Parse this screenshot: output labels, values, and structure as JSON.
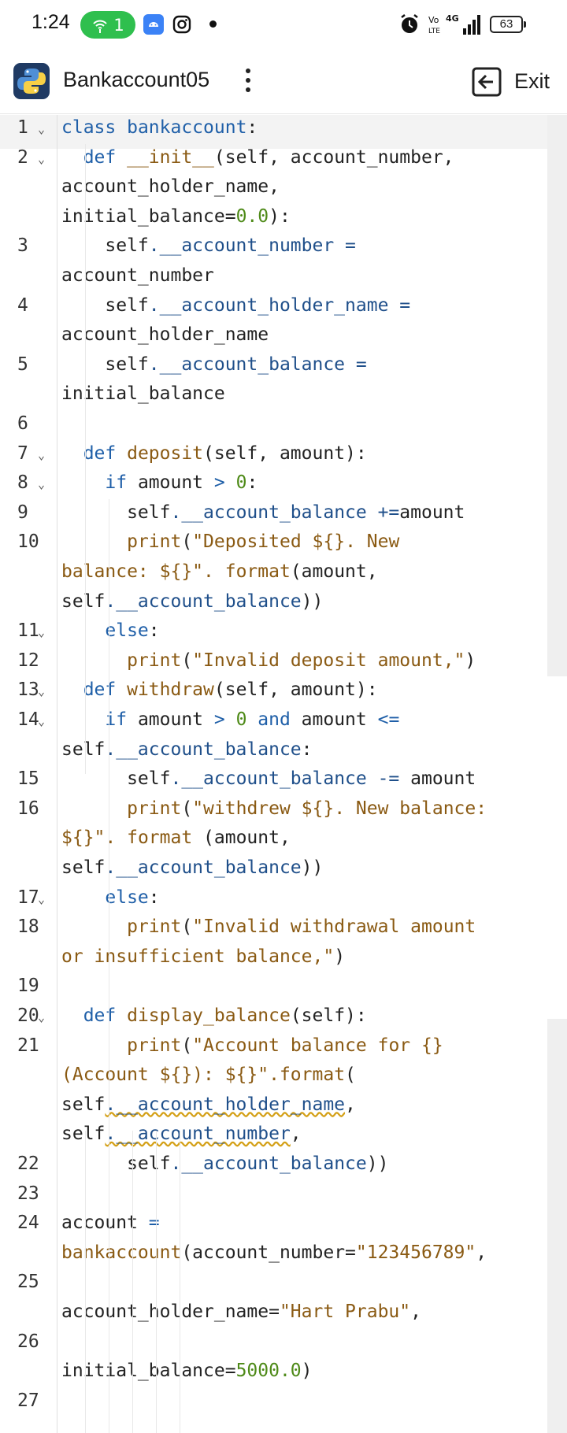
{
  "status_bar": {
    "time": "1:24",
    "hotspot_count": "1",
    "battery": "63",
    "network": "4G"
  },
  "app_bar": {
    "title": "Bankaccount05",
    "exit_label": "Exit"
  },
  "editor": {
    "active_line": "1",
    "lines": [
      {
        "n": "1",
        "fold": true
      },
      {
        "n": "2",
        "fold": true
      },
      {
        "n": "3",
        "fold": false
      },
      {
        "n": "4",
        "fold": false
      },
      {
        "n": "5",
        "fold": false
      },
      {
        "n": "6",
        "fold": false
      },
      {
        "n": "7",
        "fold": true
      },
      {
        "n": "8",
        "fold": true
      },
      {
        "n": "9",
        "fold": false
      },
      {
        "n": "10",
        "fold": false
      },
      {
        "n": "11",
        "fold": true
      },
      {
        "n": "12",
        "fold": false
      },
      {
        "n": "13",
        "fold": true
      },
      {
        "n": "14",
        "fold": true
      },
      {
        "n": "15",
        "fold": false
      },
      {
        "n": "16",
        "fold": false
      },
      {
        "n": "17",
        "fold": true
      },
      {
        "n": "18",
        "fold": false
      },
      {
        "n": "19",
        "fold": false
      },
      {
        "n": "20",
        "fold": true
      },
      {
        "n": "21",
        "fold": false
      },
      {
        "n": "22",
        "fold": false
      },
      {
        "n": "23",
        "fold": false
      },
      {
        "n": "24",
        "fold": false
      },
      {
        "n": "25",
        "fold": false
      },
      {
        "n": "26",
        "fold": false
      },
      {
        "n": "27",
        "fold": false
      }
    ],
    "rows": [
      [
        {
          "t": "class ",
          "c": "kw"
        },
        {
          "t": "bankaccount",
          "c": "kw"
        },
        {
          "t": ":",
          "c": ""
        }
      ],
      [
        {
          "t": "  def ",
          "c": "kw"
        },
        {
          "t": "__init__",
          "c": "str"
        },
        {
          "t": "(self, account_number,",
          "c": ""
        }
      ],
      [
        {
          "t": "account_holder_name,",
          "c": ""
        }
      ],
      [
        {
          "t": "initial_balance=",
          "c": ""
        },
        {
          "t": "0.0",
          "c": "num"
        },
        {
          "t": "):",
          "c": ""
        }
      ],
      [
        {
          "t": "    self",
          "c": ""
        },
        {
          "t": ".__account_number =",
          "c": "mem"
        }
      ],
      [
        {
          "t": "account_number",
          "c": ""
        }
      ],
      [
        {
          "t": "    self",
          "c": ""
        },
        {
          "t": ".__account_holder_name =",
          "c": "mem"
        }
      ],
      [
        {
          "t": "account_holder_name",
          "c": ""
        }
      ],
      [
        {
          "t": "    self",
          "c": ""
        },
        {
          "t": ".__account_balance =",
          "c": "mem"
        }
      ],
      [
        {
          "t": "initial_balance",
          "c": ""
        }
      ],
      [
        {
          "t": "",
          "c": ""
        }
      ],
      [
        {
          "t": "  def ",
          "c": "kw"
        },
        {
          "t": "deposit",
          "c": "str"
        },
        {
          "t": "(self, amount):",
          "c": ""
        }
      ],
      [
        {
          "t": "    if ",
          "c": "kw"
        },
        {
          "t": "amount ",
          "c": ""
        },
        {
          "t": "> ",
          "c": "kw"
        },
        {
          "t": "0",
          "c": "num"
        },
        {
          "t": ":",
          "c": ""
        }
      ],
      [
        {
          "t": "      self",
          "c": ""
        },
        {
          "t": ".__account_balance +=",
          "c": "mem"
        },
        {
          "t": "amount",
          "c": ""
        }
      ],
      [
        {
          "t": "      ",
          "c": ""
        },
        {
          "t": "print",
          "c": "str"
        },
        {
          "t": "(",
          "c": ""
        },
        {
          "t": "\"Deposited ${}. New",
          "c": "str"
        }
      ],
      [
        {
          "t": "balance: ${}\". ",
          "c": "str"
        },
        {
          "t": "format",
          "c": "str"
        },
        {
          "t": "(amount,",
          "c": ""
        }
      ],
      [
        {
          "t": "self",
          "c": ""
        },
        {
          "t": ".__account_balance",
          "c": "mem"
        },
        {
          "t": "))",
          "c": ""
        }
      ],
      [
        {
          "t": "    else",
          "c": "kw"
        },
        {
          "t": ":",
          "c": ""
        }
      ],
      [
        {
          "t": "      ",
          "c": ""
        },
        {
          "t": "print",
          "c": "str"
        },
        {
          "t": "(",
          "c": ""
        },
        {
          "t": "\"Invalid deposit amount,\"",
          "c": "str"
        },
        {
          "t": ")",
          "c": ""
        }
      ],
      [
        {
          "t": "  def ",
          "c": "kw"
        },
        {
          "t": "withdraw",
          "c": "str"
        },
        {
          "t": "(self, amount):",
          "c": ""
        }
      ],
      [
        {
          "t": "    if ",
          "c": "kw"
        },
        {
          "t": "amount ",
          "c": ""
        },
        {
          "t": "> ",
          "c": "kw"
        },
        {
          "t": "0 ",
          "c": "num"
        },
        {
          "t": "and ",
          "c": "kw"
        },
        {
          "t": "amount ",
          "c": ""
        },
        {
          "t": "<=",
          "c": "kw"
        }
      ],
      [
        {
          "t": "self",
          "c": ""
        },
        {
          "t": ".__account_balance",
          "c": "mem"
        },
        {
          "t": ":",
          "c": ""
        }
      ],
      [
        {
          "t": "      self",
          "c": ""
        },
        {
          "t": ".__account_balance -= ",
          "c": "mem"
        },
        {
          "t": "amount",
          "c": ""
        }
      ],
      [
        {
          "t": "      ",
          "c": ""
        },
        {
          "t": "print",
          "c": "str"
        },
        {
          "t": "(",
          "c": ""
        },
        {
          "t": "\"withdrew ${}. New balance:",
          "c": "str"
        }
      ],
      [
        {
          "t": "${}\". ",
          "c": "str"
        },
        {
          "t": "format ",
          "c": "str"
        },
        {
          "t": "(amount,",
          "c": ""
        }
      ],
      [
        {
          "t": "self",
          "c": ""
        },
        {
          "t": ".__account_balance",
          "c": "mem"
        },
        {
          "t": "))",
          "c": ""
        }
      ],
      [
        {
          "t": "    else",
          "c": "kw"
        },
        {
          "t": ":",
          "c": ""
        }
      ],
      [
        {
          "t": "      ",
          "c": ""
        },
        {
          "t": "print",
          "c": "str"
        },
        {
          "t": "(",
          "c": ""
        },
        {
          "t": "\"Invalid withdrawal amount",
          "c": "str"
        }
      ],
      [
        {
          "t": "or insufficient balance,\"",
          "c": "str"
        },
        {
          "t": ")",
          "c": ""
        }
      ],
      [
        {
          "t": "",
          "c": ""
        }
      ],
      [
        {
          "t": "  def ",
          "c": "kw"
        },
        {
          "t": "display_balance",
          "c": "str"
        },
        {
          "t": "(self):",
          "c": ""
        }
      ],
      [
        {
          "t": "      ",
          "c": ""
        },
        {
          "t": "print",
          "c": "str"
        },
        {
          "t": "(",
          "c": ""
        },
        {
          "t": "\"Account balance for {}",
          "c": "str"
        }
      ],
      [
        {
          "t": "(Account ${}): ${}\"",
          "c": "str"
        },
        {
          "t": ".format",
          "c": "str"
        },
        {
          "t": "(",
          "c": ""
        }
      ],
      [
        {
          "t": "self",
          "c": ""
        },
        {
          "t": ".__account_holder_name",
          "c": "mem"
        },
        {
          "t": ",",
          "c": ""
        }
      ],
      [
        {
          "t": "self",
          "c": ""
        },
        {
          "t": ".__account_number",
          "c": "mem"
        },
        {
          "t": ",",
          "c": ""
        }
      ],
      [
        {
          "t": "      self",
          "c": ""
        },
        {
          "t": ".__account_balance",
          "c": "mem"
        },
        {
          "t": "))",
          "c": ""
        }
      ],
      [
        {
          "t": "",
          "c": ""
        }
      ],
      [
        {
          "t": "account ",
          "c": ""
        },
        {
          "t": "=",
          "c": "kw"
        }
      ],
      [
        {
          "t": "bankaccount",
          "c": "str"
        },
        {
          "t": "(account_number=",
          "c": ""
        },
        {
          "t": "\"123456789\"",
          "c": "str"
        },
        {
          "t": ",",
          "c": ""
        }
      ],
      [
        {
          "t": "",
          "c": ""
        }
      ],
      [
        {
          "t": "account_holder_name=",
          "c": ""
        },
        {
          "t": "\"Hart Prabu\"",
          "c": "str"
        },
        {
          "t": ",",
          "c": ""
        }
      ],
      [
        {
          "t": "",
          "c": ""
        }
      ],
      [
        {
          "t": "initial_balance=",
          "c": ""
        },
        {
          "t": "5000.0",
          "c": "num"
        },
        {
          "t": ")",
          "c": ""
        }
      ],
      [
        {
          "t": "",
          "c": ""
        }
      ]
    ]
  }
}
